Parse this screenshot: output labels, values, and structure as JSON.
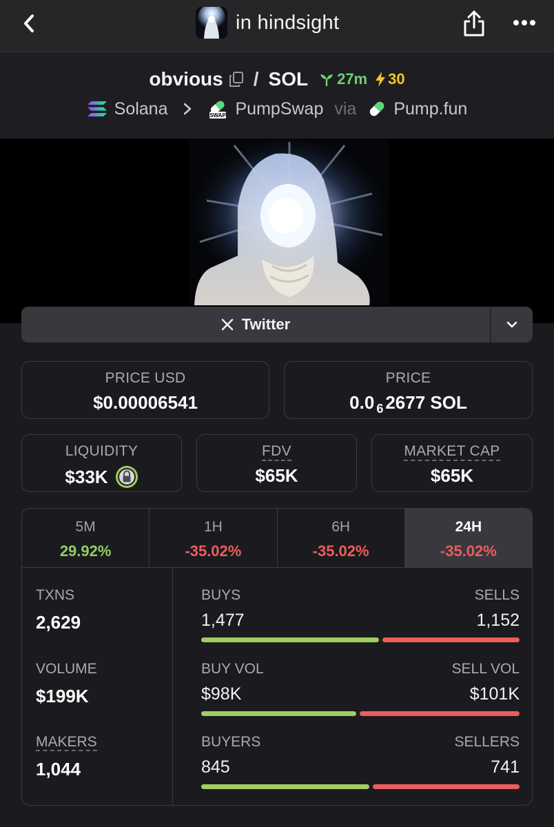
{
  "header": {
    "title": "in hindsight"
  },
  "pair": {
    "base": "obvious",
    "quote": "SOL",
    "age": "27m",
    "boosts": "30",
    "chain": "Solana",
    "dex": "PumpSwap",
    "via_label": "via",
    "launchpad": "Pump.fun",
    "dex_badge": "SWAP"
  },
  "links": {
    "twitter": "Twitter"
  },
  "prices": {
    "price_usd_label": "PRICE USD",
    "price_usd": "$0.00006541",
    "price_label": "PRICE",
    "price_prefix": "0.0",
    "price_zero_count": "6",
    "price_suffix": "2677 SOL"
  },
  "stats": {
    "liquidity_label": "LIQUIDITY",
    "liquidity": "$33K",
    "fdv_label": "FDV",
    "fdv": "$65K",
    "mcap_label": "MARKET CAP",
    "mcap": "$65K"
  },
  "timeframes": [
    {
      "label": "5M",
      "change": "29.92%"
    },
    {
      "label": "1H",
      "change": "-35.02%"
    },
    {
      "label": "6H",
      "change": "-35.02%"
    },
    {
      "label": "24H",
      "change": "-35.02%"
    }
  ],
  "metrics": {
    "txns_label": "TXNS",
    "txns": "2,629",
    "volume_label": "VOLUME",
    "volume": "$199K",
    "makers_label": "MAKERS",
    "makers": "1,044",
    "buys_label": "BUYS",
    "buys": "1,477",
    "sells_label": "SELLS",
    "sells": "1,152",
    "buy_vol_label": "BUY VOL",
    "buy_vol": "$98K",
    "sell_vol_label": "SELL VOL",
    "sell_vol": "$101K",
    "buyers_label": "BUYERS",
    "buyers": "845",
    "sellers_label": "SELLERS",
    "sellers": "741"
  },
  "colors": {
    "positive": "#8fcf63",
    "negative": "#ec5d5b",
    "buy_bar": "#9fcf5e",
    "sell_bar": "#ec5d5b",
    "age_green": "#6fcf73",
    "boost_yellow": "#f3c623"
  },
  "ratios": {
    "buys_fraction": 0.562,
    "buy_vol_fraction": 0.492,
    "buyers_fraction": 0.533
  }
}
